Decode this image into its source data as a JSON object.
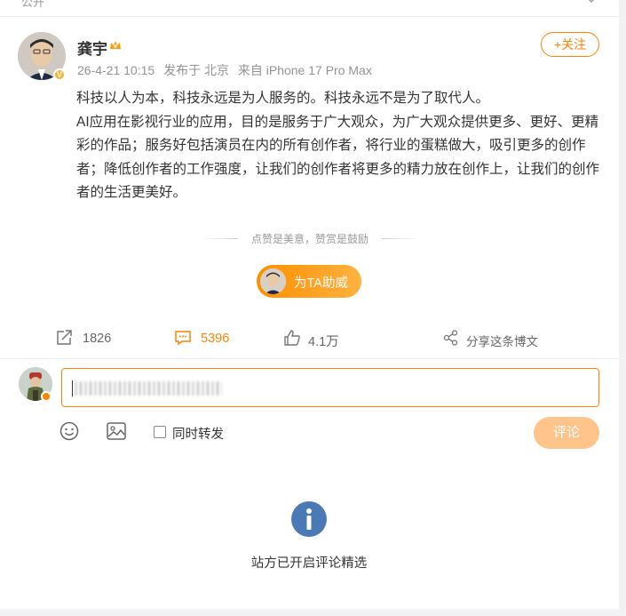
{
  "top_strip": {
    "visibility_label": "公开"
  },
  "author": {
    "name": "龚宇",
    "timestamp": "26-4-21 10:15",
    "location": "发布于 北京",
    "source": "来自 iPhone 17 Pro Max",
    "follow_label": "+关注"
  },
  "post": {
    "paragraphs": [
      "科技以人为本，科技永远是为人服务的。科技永远不是为了取代人。",
      "AI应用在影视行业的应用，目的是服务于广大观众，为广大观众提供更多、更好、更精彩的作品；服务好包括演员在内的所有创作者，将行业的蛋糕做大，吸引更多的创作者；降低创作者的工作强度，让我们的创作者将更多的精力放在创作上，让我们的创作者的生活更美好。"
    ]
  },
  "reward": {
    "tagline": "点赞是美意，赞赏是鼓励",
    "button_label": "为TA助威"
  },
  "actions": {
    "repost_count": "1826",
    "comment_count": "5396",
    "like_count": "4.1万",
    "share_label": "分享这条博文"
  },
  "composer": {
    "also_repost_label": "同时转发",
    "submit_label": "评论"
  },
  "notice": {
    "text": "站方已开启评论精选"
  },
  "colors": {
    "accent": "#ff8200",
    "submit_disabled": "#ffc48a",
    "info_blue": "#4a7ab5"
  }
}
